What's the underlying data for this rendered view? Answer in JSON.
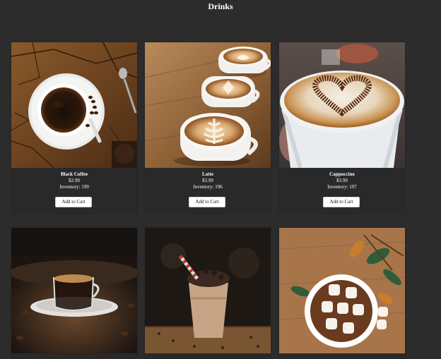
{
  "page": {
    "title": "Drinks"
  },
  "products": [
    {
      "name": "Black Coffee",
      "price": "$2.99",
      "inventory": "Inventory: 199",
      "button": "Add to Cart"
    },
    {
      "name": "Latte",
      "price": "$3.99",
      "inventory": "Inventory: 196",
      "button": "Add to Cart"
    },
    {
      "name": "Cappuccino",
      "price": "$3.99",
      "inventory": "Inventory: 197",
      "button": "Add to Cart"
    }
  ],
  "photos": [
    {
      "subject": "black-coffee-photo"
    },
    {
      "subject": "latte-photo"
    },
    {
      "subject": "cappuccino-photo"
    },
    {
      "subject": "espresso-photo"
    },
    {
      "subject": "frappe-photo"
    },
    {
      "subject": "hot-chocolate-photo"
    }
  ]
}
